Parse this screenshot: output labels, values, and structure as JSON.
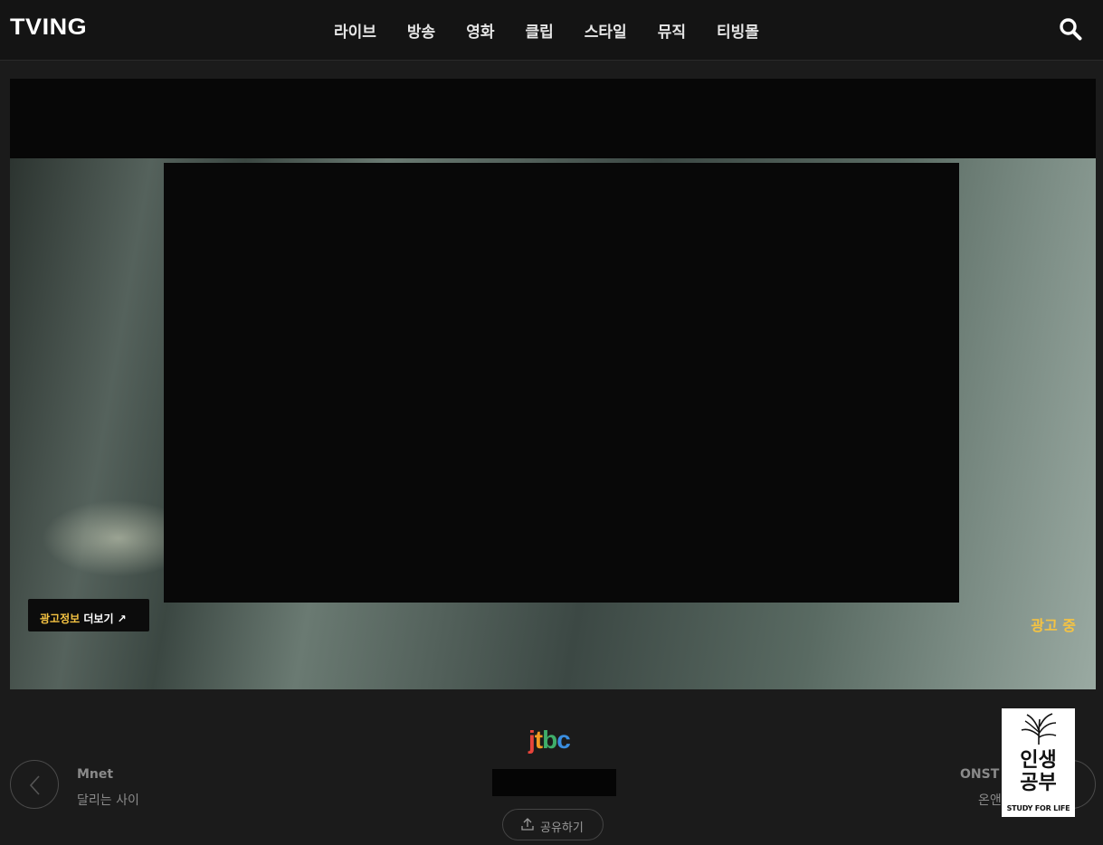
{
  "header": {
    "logo": "TVING",
    "nav": [
      "라이브",
      "방송",
      "영화",
      "클립",
      "스타일",
      "뮤직",
      "티빙몰"
    ],
    "search_icon": "search-icon"
  },
  "player": {
    "ad_info_label": "광고정보",
    "ad_more_label": "더보기",
    "ad_more_arrow": "↗",
    "ad_status": "광고 중"
  },
  "channel_nav": {
    "prev": {
      "channel": "Mnet",
      "title": "달리는 사이"
    },
    "next": {
      "channel": "ONST",
      "title": "온앤"
    },
    "current_channel_logo": "jtbc",
    "share_label": "공유하기"
  },
  "banner": {
    "line1": "인생",
    "line2": "공부",
    "tagline": "STUDY FOR LIFE"
  },
  "colors": {
    "accent_yellow": "#f5c342",
    "background": "#1b1b1b",
    "header_bg": "#141414"
  }
}
